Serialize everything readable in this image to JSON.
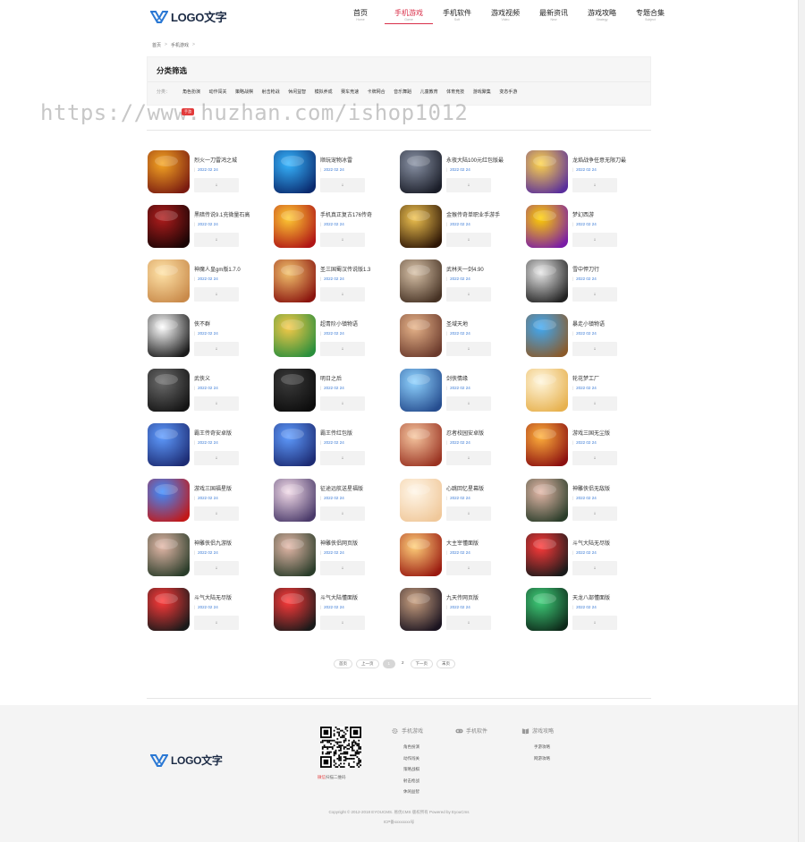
{
  "header": {
    "logo_text": "LOGO文字",
    "nav": [
      {
        "zh": "首页",
        "en": "Home"
      },
      {
        "zh": "手机游戏",
        "en": "Game",
        "active": true
      },
      {
        "zh": "手机软件",
        "en": "Soft"
      },
      {
        "zh": "游戏视频",
        "en": "Video"
      },
      {
        "zh": "最新资讯",
        "en": "New"
      },
      {
        "zh": "游戏攻略",
        "en": "Strategy"
      },
      {
        "zh": "专题合集",
        "en": "Subject"
      }
    ]
  },
  "breadcrumb": {
    "home": "首页",
    "current": "手机游戏",
    "sep": ">"
  },
  "filter": {
    "title": "分类筛选",
    "label": "分类：",
    "options": [
      "角色扮演",
      "动作闯关",
      "策略战棋",
      "射击枪战",
      "休闲益智",
      "模拟养成",
      "赛车竞速",
      "卡牌网合",
      "音乐舞蹈",
      "儿童教育",
      "体育竞技",
      "游戏聚集",
      "变态手游"
    ]
  },
  "watermark": "https://www.huzhan.com/ishop1012",
  "red_tag": "手游",
  "download_label": "↓",
  "games": [
    {
      "name": "烈火一刀雷鸿之城",
      "date": "2022 02 24",
      "colors": [
        "#f5a623",
        "#7a1b10"
      ]
    },
    {
      "name": "顺玩宠物冰雷",
      "date": "2022 02 24",
      "colors": [
        "#37b6ff",
        "#0a2a6e"
      ]
    },
    {
      "name": "永夜大陆100元红包版最",
      "date": "2022 02 24",
      "colors": [
        "#8a93a6",
        "#1a1d28"
      ]
    },
    {
      "name": "龙焰战争任意无限刀最",
      "date": "2022 02 24",
      "colors": [
        "#ffd54a",
        "#5a2f9c"
      ]
    },
    {
      "name": "黑暗传说9.1充微量石高",
      "date": "2022 02 24",
      "colors": [
        "#b01c1c",
        "#1a0505"
      ]
    },
    {
      "name": "手机真正复古176传奇",
      "date": "2022 02 24",
      "colors": [
        "#ffcc33",
        "#b01515"
      ]
    },
    {
      "name": "金猴传奇单职业手游手",
      "date": "2022 02 24",
      "colors": [
        "#f0c350",
        "#2e1606"
      ]
    },
    {
      "name": "梦幻西游",
      "date": "2022 02 24",
      "colors": [
        "#ffd000",
        "#7a1ca6"
      ]
    },
    {
      "name": "神魔人皇gm版1.7.0",
      "date": "2022 02 24",
      "colors": [
        "#ffe3a8",
        "#c98a4a"
      ]
    },
    {
      "name": "圣三国蜀汉传说版1.3",
      "date": "2022 02 24",
      "colors": [
        "#f2c26c",
        "#8a140e"
      ]
    },
    {
      "name": "武林天一剑4.90",
      "date": "2022 02 24",
      "colors": [
        "#d8c2a8",
        "#463224"
      ]
    },
    {
      "name": "雪中悍刀行",
      "date": "2022 02 24",
      "colors": [
        "#e8e8e8",
        "#222222"
      ]
    },
    {
      "name": "侠不群",
      "date": "2022 02 24",
      "colors": [
        "#ffffff",
        "#1b1b1b"
      ]
    },
    {
      "name": "超青阶小镇物语",
      "date": "2022 02 24",
      "colors": [
        "#f7c948",
        "#2a8f3c"
      ]
    },
    {
      "name": "圣域天地",
      "date": "2022 02 24",
      "colors": [
        "#e7b48a",
        "#6b3a2c"
      ]
    },
    {
      "name": "暴走小镇物语",
      "date": "2022 02 24",
      "colors": [
        "#3fa9f5",
        "#8a5a2a"
      ]
    },
    {
      "name": "武侠义",
      "date": "2022 02 24",
      "colors": [
        "#6b6b6b",
        "#141414"
      ]
    },
    {
      "name": "明日之后",
      "date": "2022 02 24",
      "colors": [
        "#3a3a3a",
        "#0c0c0c"
      ]
    },
    {
      "name": "剑侠情缘",
      "date": "2022 02 24",
      "colors": [
        "#8fd3ff",
        "#264d8f"
      ]
    },
    {
      "name": "轮花梦工厂",
      "date": "2022 02 24",
      "colors": [
        "#fff6dd",
        "#e7b14e"
      ]
    },
    {
      "name": "霸王传奇安卓版",
      "date": "2022 02 24",
      "colors": [
        "#5f9cff",
        "#1d2c74"
      ]
    },
    {
      "name": "霸王传红包版",
      "date": "2022 02 24",
      "colors": [
        "#5f9cff",
        "#1d2c74"
      ]
    },
    {
      "name": "忍者校园安卓版",
      "date": "2022 02 24",
      "colors": [
        "#f6c7a0",
        "#9a3322"
      ]
    },
    {
      "name": "游戏三国无尘版",
      "date": "2022 02 24",
      "colors": [
        "#ffb13b",
        "#8c1010"
      ]
    },
    {
      "name": "游戏三国福星版",
      "date": "2022 02 24",
      "colors": [
        "#3c8cff",
        "#c21818"
      ]
    },
    {
      "name": "征途远航送星福版",
      "date": "2022 02 24",
      "colors": [
        "#f2dbe8",
        "#4a3a6a"
      ]
    },
    {
      "name": "心跳回忆星幕版",
      "date": "2022 02 24",
      "colors": [
        "#fff6e8",
        "#f0c89a"
      ]
    },
    {
      "name": "神雕侠侣无敌版",
      "date": "2022 02 24",
      "colors": [
        "#e4b8a8",
        "#2a3d2a"
      ]
    },
    {
      "name": "神雕侠侣九游版",
      "date": "2022 02 24",
      "colors": [
        "#e4b8a8",
        "#2a3d2a"
      ]
    },
    {
      "name": "神雕侠侣网页版",
      "date": "2022 02 24",
      "colors": [
        "#e4b8a8",
        "#2a3d2a"
      ]
    },
    {
      "name": "大主宰懂面版",
      "date": "2022 02 24",
      "colors": [
        "#ffd07a",
        "#9a1a10"
      ]
    },
    {
      "name": "斗气大陆无尽版",
      "date": "2022 02 24",
      "colors": [
        "#ff3a3a",
        "#1a1a1a"
      ]
    },
    {
      "name": "斗气大陆无尽版",
      "date": "2022 02 24",
      "colors": [
        "#ff3a3a",
        "#1a1a1a"
      ]
    },
    {
      "name": "斗气大陆懂面版",
      "date": "2022 02 24",
      "colors": [
        "#ff3a3a",
        "#1a1a1a"
      ]
    },
    {
      "name": "九天传网页版",
      "date": "2022 02 24",
      "colors": [
        "#c9a080",
        "#1b1420"
      ]
    },
    {
      "name": "天龙八部懂面版",
      "date": "2022 02 24",
      "colors": [
        "#3fd07a",
        "#0e2a1a"
      ]
    }
  ],
  "pager": {
    "first": "首页",
    "prev": "上一页",
    "pages": [
      "1",
      "2"
    ],
    "current": "1",
    "next": "下一页",
    "last": "末页"
  },
  "footer": {
    "logo_text": "LOGO文字",
    "qr_caption_hl": "微信",
    "qr_caption": "扫描二维码",
    "columns": [
      {
        "title": "手机游戏",
        "icon": "gear-icon",
        "links": [
          "角色扮演",
          "动作闯关",
          "策略战棋",
          "射击枪战",
          "休闲益智"
        ]
      },
      {
        "title": "手机软件",
        "icon": "gamepad-icon",
        "links": []
      },
      {
        "title": "游戏攻略",
        "icon": "book-icon",
        "links": [
          "手游攻略",
          "网游攻略"
        ]
      }
    ],
    "copyright": "Copyright © 2012-2018 EYOUCMS. 易优CMS 版权所有 Powered by EyouCms",
    "icp": "ICP备xxxxxxxx号"
  },
  "colors": {
    "accent": "#d9304a",
    "date": "#3a7ad6",
    "logo": "#1b2a44",
    "logo_mark": "#2a78d4"
  }
}
